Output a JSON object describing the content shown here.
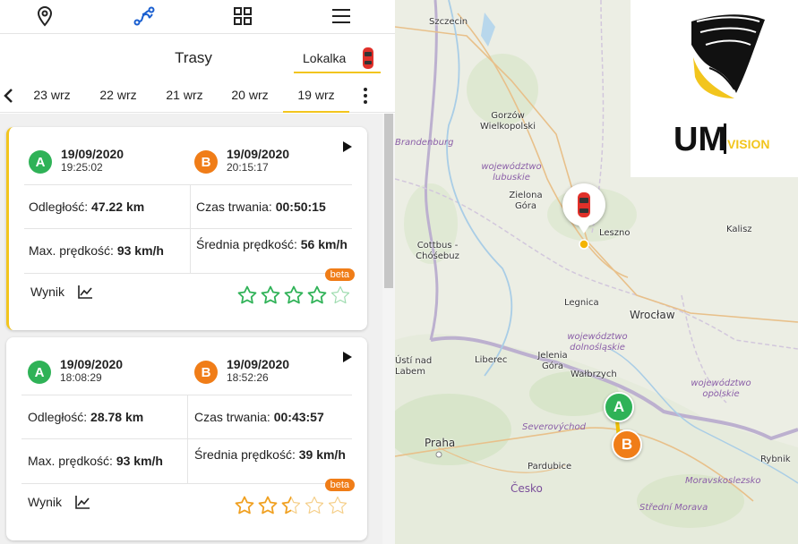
{
  "nav": {
    "icons": [
      "location-icon",
      "route-icon",
      "grid-icon",
      "menu-icon"
    ],
    "active": "route-icon"
  },
  "header": {
    "title": "Trasy",
    "vehicle_label": "Lokalka"
  },
  "date_tabs": [
    "23 wrz",
    "22 wrz",
    "21 wrz",
    "20 wrz",
    "19 wrz"
  ],
  "active_tab": "19 wrz",
  "colors": {
    "accent": "#f2c51d",
    "start": "#2fb257",
    "end": "#f07d18",
    "star_green": "#2fb257",
    "star_orange": "#f0a020"
  },
  "trips": [
    {
      "start": {
        "badge": "A",
        "date": "19/09/2020",
        "time": "19:25:02"
      },
      "end": {
        "badge": "B",
        "date": "19/09/2020",
        "time": "20:15:17"
      },
      "distance_label": "Odległość:",
      "distance": "47.22 km",
      "duration_label": "Czas trwania:",
      "duration": "00:50:15",
      "max_speed_label": "Max. prędkość:",
      "max_speed": "93 km/h",
      "avg_speed_label": "Średnia prędkość:",
      "avg_speed": "56 km/h",
      "score_label": "Wynik",
      "beta": "beta",
      "rating": 4,
      "rating_color": "green"
    },
    {
      "start": {
        "badge": "A",
        "date": "19/09/2020",
        "time": "18:08:29"
      },
      "end": {
        "badge": "B",
        "date": "19/09/2020",
        "time": "18:52:26"
      },
      "distance_label": "Odległość:",
      "distance": "28.78 km",
      "duration_label": "Czas trwania:",
      "duration": "00:43:57",
      "max_speed_label": "Max. prędkość:",
      "max_speed": "93 km/h",
      "avg_speed_label": "Średnia prędkość:",
      "avg_speed": "39 km/h",
      "score_label": "Wynik",
      "beta": "beta",
      "rating": 2.5,
      "rating_color": "orange"
    }
  ],
  "map": {
    "cities": [
      "Szczecin",
      "Gorzów Wielkopolski",
      "Zielona Góra",
      "Leszno",
      "Kalisz",
      "Cottbus - Chóśebuz",
      "Legnica",
      "Wrocław",
      "Liberec",
      "Jelenia Góra",
      "Wałbrzych",
      "Ústí nad Labem",
      "Praha",
      "Pardubice",
      "Rybnik"
    ],
    "regions": [
      "Brandenburg",
      "województwo lubuskie",
      "województwo dolnośląskie",
      "województwo opolskie",
      "Severovýchod",
      "Moravskoslezsko",
      "Střední Morava"
    ],
    "country": "Česko",
    "marker_a": "A",
    "marker_b": "B"
  },
  "logo": {
    "text_a": "UM",
    "text_b": "VISION"
  }
}
